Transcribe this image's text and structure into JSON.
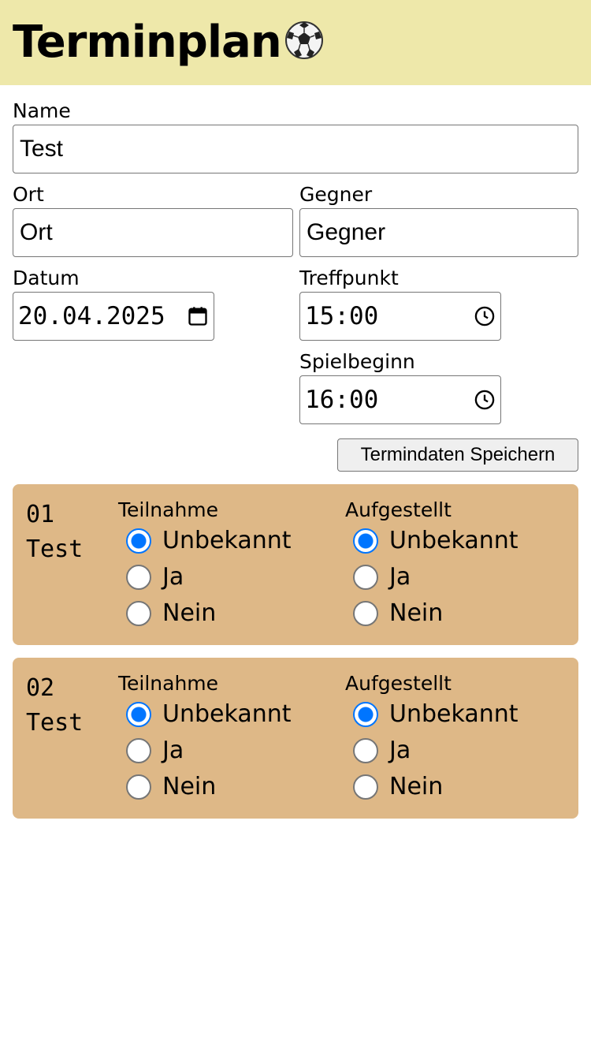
{
  "header": {
    "title": "Terminplan",
    "icon": "soccer-ball-icon",
    "bg": "#eee8aa"
  },
  "form": {
    "name_label": "Name",
    "name_value": "Test",
    "ort_label": "Ort",
    "ort_value": "Ort",
    "gegner_label": "Gegner",
    "gegner_value": "Gegner",
    "datum_label": "Datum",
    "datum_value": "20.04.2025",
    "treffpunkt_label": "Treffpunkt",
    "treffpunkt_value": "15:00",
    "spielbeginn_label": "Spielbeginn",
    "spielbeginn_value": "16:00",
    "save_label": "Termindaten Speichern"
  },
  "players": [
    {
      "number": "01",
      "name": "Test",
      "teilnahme": {
        "label": "Teilnahme",
        "options": [
          "Unbekannt",
          "Ja",
          "Nein"
        ],
        "selected": "Unbekannt"
      },
      "aufgestellt": {
        "label": "Aufgestellt",
        "options": [
          "Unbekannt",
          "Ja",
          "Nein"
        ],
        "selected": "Unbekannt"
      }
    },
    {
      "number": "02",
      "name": "Test",
      "teilnahme": {
        "label": "Teilnahme",
        "options": [
          "Unbekannt",
          "Ja",
          "Nein"
        ],
        "selected": "Unbekannt"
      },
      "aufgestellt": {
        "label": "Aufgestellt",
        "options": [
          "Unbekannt",
          "Ja",
          "Nein"
        ],
        "selected": "Unbekannt"
      }
    }
  ],
  "colors": {
    "card_bg": "#deb887",
    "radio_accent": "#0075ff"
  }
}
